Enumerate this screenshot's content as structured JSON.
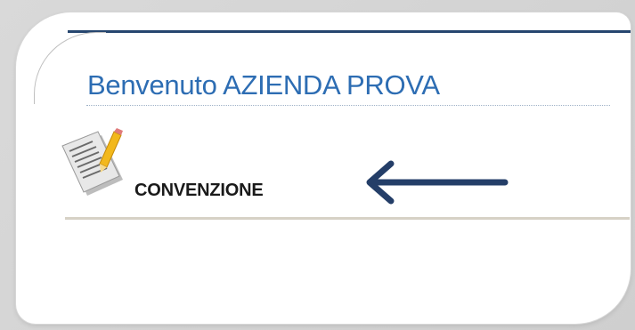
{
  "header": {
    "welcome_title": "Benvenuto AZIENDA PROVA"
  },
  "menu": {
    "items": [
      {
        "label": "CONVENZIONE",
        "icon": "document-pencil-icon"
      }
    ]
  },
  "annotation": {
    "arrow_icon": "arrow-left-icon",
    "arrow_color": "#243e68"
  },
  "colors": {
    "title": "#2d6db3",
    "accent_strip": "#26466f",
    "separator": "#d6d1c6"
  }
}
